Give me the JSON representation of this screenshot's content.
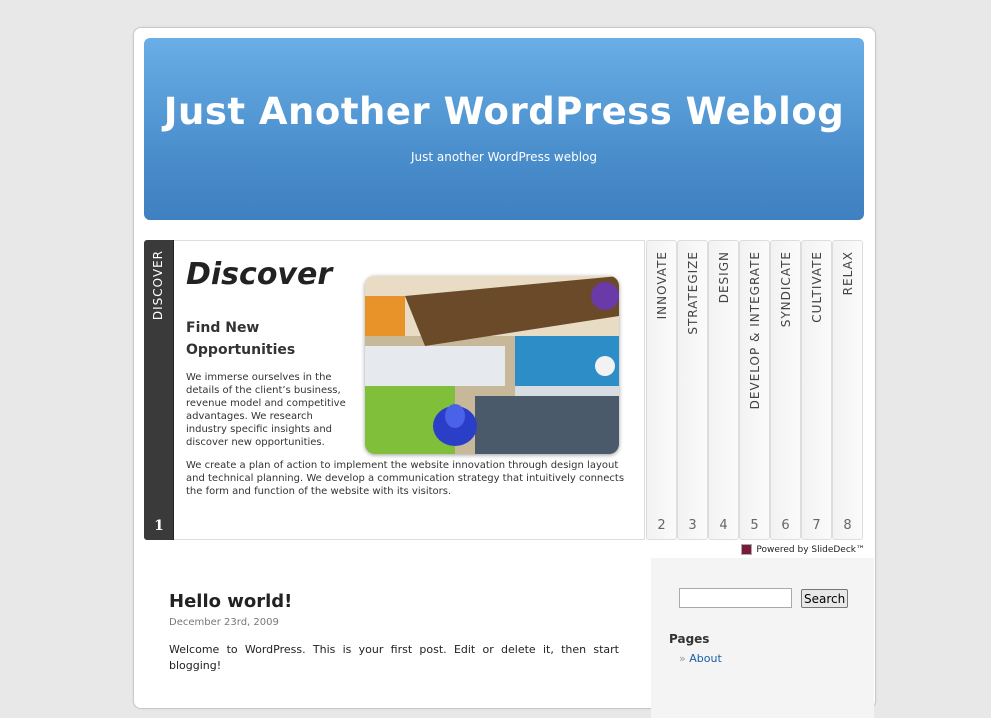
{
  "header": {
    "title": "Just Another WordPress Weblog",
    "description": "Just another WordPress weblog"
  },
  "slidedeck": {
    "active": {
      "spine_label": "DISCOVER",
      "number": "1",
      "heading": "Discover",
      "subheading": "Find New Opportunities",
      "paragraph1": "We immerse ourselves in the details of the client’s business, revenue model and competitive advantages. We research industry specific insights and discover new opportunities.",
      "paragraph2": "We create a plan of action to implement the website innovation through design layout and technical planning. We develop a communication strategy that intuitively connects the form and function of the website with its visitors."
    },
    "spines": [
      {
        "label": "INNOVATE",
        "number": "2"
      },
      {
        "label": "STRATEGIZE",
        "number": "3"
      },
      {
        "label": "DESIGN",
        "number": "4"
      },
      {
        "label": "DEVELOP & INTEGRATE",
        "number": "5"
      },
      {
        "label": "SYNDICATE",
        "number": "6"
      },
      {
        "label": "CULTIVATE",
        "number": "7"
      },
      {
        "label": "RELAX",
        "number": "8"
      }
    ],
    "powered_by": "Powered by SlideDeck™"
  },
  "post": {
    "title": "Hello world!",
    "date": "December 23rd, 2009",
    "body": "Welcome to WordPress. This is your first post. Edit or delete it, then start blogging!"
  },
  "sidebar": {
    "search_value": "",
    "search_button": "Search",
    "pages_title": "Pages",
    "pages": [
      {
        "label": "About"
      }
    ]
  },
  "colors": {
    "header_top": "#6aaee6",
    "header_bottom": "#3f80c0",
    "link": "#1a5fa8"
  }
}
